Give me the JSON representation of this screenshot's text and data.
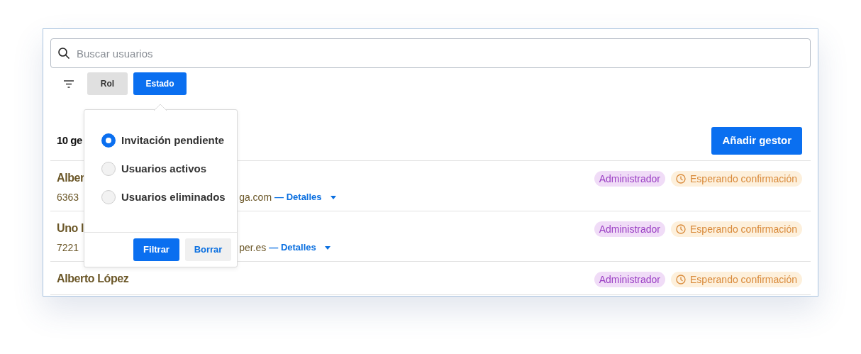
{
  "search": {
    "placeholder": "Buscar usuarios"
  },
  "filters": [
    {
      "label": "Rol",
      "selected": false
    },
    {
      "label": "Estado",
      "selected": true
    }
  ],
  "header": {
    "count_text": "10 ge",
    "add_button": "Añadir gestor"
  },
  "rows": [
    {
      "name": "Alber",
      "phone": "6363",
      "email": "ga.com",
      "details": "— Detalles",
      "tags": [
        {
          "label": "Administrador",
          "kind": "role"
        },
        {
          "label": "Esperando confirmación",
          "kind": "status"
        }
      ]
    },
    {
      "name": "Uno l",
      "phone": "7221",
      "email": "per.es",
      "details": "— Detalles",
      "tags": [
        {
          "label": "Administrador",
          "kind": "role"
        },
        {
          "label": "Esperando confirmación",
          "kind": "status"
        }
      ]
    },
    {
      "name": "Alberto López",
      "tags": [
        {
          "label": "Administrador",
          "kind": "role"
        },
        {
          "label": "Esperando confirmación",
          "kind": "status"
        }
      ]
    }
  ],
  "popup": {
    "options": [
      {
        "label": "Invitación pendiente",
        "selected": true
      },
      {
        "label": "Usuarios activos",
        "selected": false
      },
      {
        "label": "Usuarios eliminados",
        "selected": false
      }
    ],
    "buttons": [
      {
        "label": "Filtrar",
        "kind": "primary"
      },
      {
        "label": "Borrar",
        "kind": "secondary"
      }
    ]
  }
}
